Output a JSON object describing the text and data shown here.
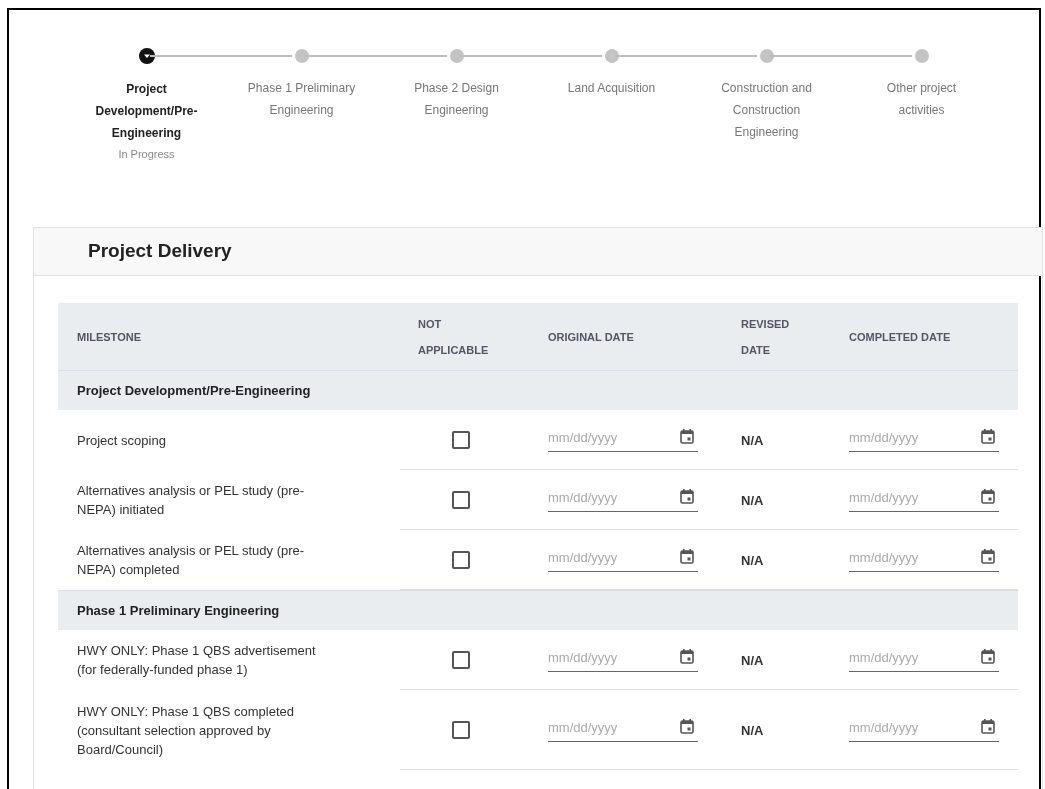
{
  "steps": [
    {
      "label": "Project Development/Pre-Engineering",
      "status": "In Progress",
      "selected": true
    },
    {
      "label": "Phase 1 Preliminary Engineering",
      "selected": false
    },
    {
      "label": "Phase 2 Design Engineering",
      "selected": false
    },
    {
      "label": "Land Acquisition",
      "selected": false
    },
    {
      "label": "Construction and Construction Engineering",
      "selected": false
    },
    {
      "label": "Other project activities",
      "selected": false
    }
  ],
  "card": {
    "title": "Project Delivery",
    "table": {
      "columns": [
        "MILESTONE",
        "NOT APPLICABLE",
        "ORIGINAL DATE",
        "REVISED DATE",
        "COMPLETED DATE"
      ],
      "rows": [
        {
          "kind": "section",
          "label": "Project Development/Pre-Engineering"
        },
        {
          "kind": "milestone",
          "milestone": "Project scoping",
          "not_applicable": false,
          "original_date": {
            "placeholder": "mm/dd/yyyy"
          },
          "revised_date": "N/A",
          "completed_date": {
            "placeholder": "mm/dd/yyyy"
          }
        },
        {
          "kind": "milestone",
          "milestone": "Alternatives analysis or PEL study (pre-NEPA) initiated",
          "not_applicable": false,
          "original_date": {
            "placeholder": "mm/dd/yyyy"
          },
          "revised_date": "N/A",
          "completed_date": {
            "placeholder": "mm/dd/yyyy"
          }
        },
        {
          "kind": "milestone",
          "milestone": "Alternatives analysis or PEL study (pre-NEPA) completed",
          "not_applicable": false,
          "original_date": {
            "placeholder": "mm/dd/yyyy"
          },
          "revised_date": "N/A",
          "completed_date": {
            "placeholder": "mm/dd/yyyy"
          }
        },
        {
          "kind": "section",
          "label": "Phase 1 Preliminary Engineering"
        },
        {
          "kind": "milestone",
          "milestone": "HWY ONLY: Phase 1 QBS advertisement (for federally-funded phase 1)",
          "not_applicable": false,
          "original_date": {
            "placeholder": "mm/dd/yyyy"
          },
          "revised_date": "N/A",
          "completed_date": {
            "placeholder": "mm/dd/yyyy"
          }
        },
        {
          "kind": "milestone",
          "milestone": "HWY ONLY: Phase 1 QBS completed (consultant selection approved by Board/Council)",
          "not_applicable": false,
          "original_date": {
            "placeholder": "mm/dd/yyyy"
          },
          "revised_date": "N/A",
          "completed_date": {
            "placeholder": "mm/dd/yyyy"
          }
        }
      ]
    }
  }
}
